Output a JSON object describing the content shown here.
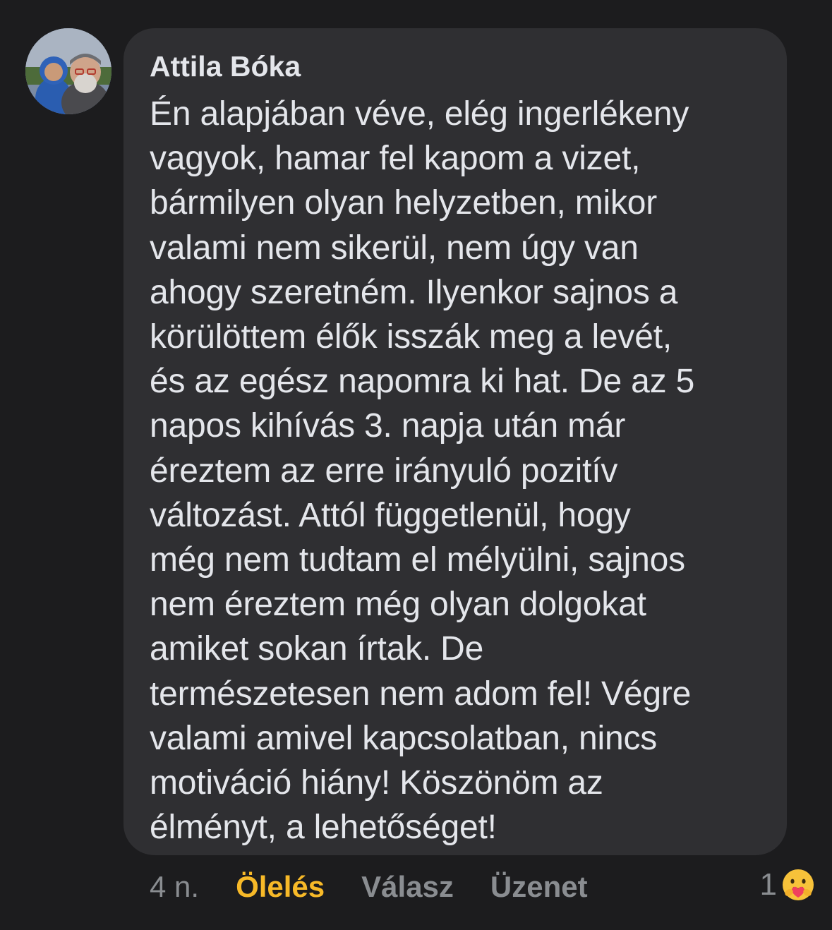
{
  "comment": {
    "author": "Attila Bóka",
    "lines": [
      "Én alapjában véve, elég ingerlékeny",
      "vagyok, hamar fel kapom a vizet,",
      "bármilyen olyan helyzetben, mikor",
      "valami nem sikerül, nem úgy van",
      "ahogy szeretném. Ilyenkor sajnos a",
      "körülöttem élők isszák meg a levét,",
      "és az egész napomra ki hat. De az 5",
      "napos kihívás 3. napja után már",
      "éreztem az erre irányuló pozitív",
      "változást. Attól függetlenül, hogy",
      "még nem tudtam el mélyülni, sajnos",
      "nem éreztem még olyan dolgokat",
      "amiket sokan írtak. De",
      "természetesen nem adom fel! Végre",
      "valami amivel kapcsolatban, nincs",
      "motiváció hiány! Köszönöm az",
      "élményt, a lehetőséget!"
    ]
  },
  "actions": {
    "time": "4 n.",
    "hug_label": "Ölelés",
    "reply_label": "Válasz",
    "message_label": "Üzenet"
  },
  "reactions": {
    "count": "1",
    "icon": "care-reaction-icon"
  },
  "colors": {
    "background": "#1c1c1e",
    "bubble": "#2f2f32",
    "text": "#e4e6eb",
    "muted": "#8a8d91",
    "accent_hug": "#f7b928"
  }
}
